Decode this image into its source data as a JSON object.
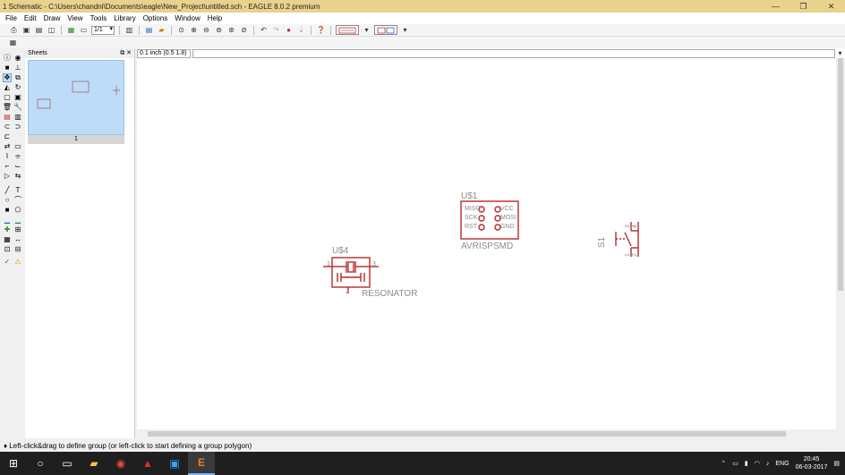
{
  "window": {
    "title": "1 Schematic - C:\\Users\\chandni\\Documents\\eagle\\New_Project\\untitled.sch - EAGLE 8.0.2 premium"
  },
  "menu": [
    "File",
    "Edit",
    "Draw",
    "View",
    "Tools",
    "Library",
    "Options",
    "Window",
    "Help"
  ],
  "toolbar": {
    "sheet_value": "1/1"
  },
  "sheets_panel": {
    "title": "Sheets",
    "sheet_number": "1"
  },
  "command_bar": {
    "coordinate": "0.1 inch (0.5 1.8)",
    "command_text": ""
  },
  "schematic": {
    "parts": [
      {
        "name": "U$1",
        "value": "AVRISPSMD",
        "pins_left": [
          "MISO",
          "SCK",
          "RST"
        ],
        "pins_right": [
          "VCC",
          "MOSI",
          "GND"
        ]
      },
      {
        "name": "U$4",
        "value": "RESONATOR",
        "pin_numbers": [
          "1",
          "2",
          "3"
        ]
      },
      {
        "name": "S1",
        "pin_numbers": [
          "3",
          "4",
          "1",
          "2"
        ]
      }
    ]
  },
  "status": {
    "text": "♦ Left-click&drag to define group (or left-click to start defining a group polygon)"
  },
  "taskbar": {
    "lang": "ENG",
    "time": "20:45",
    "date": "06-03-2017"
  },
  "colors": {
    "titlebar": "#e9d28d",
    "schematic_symbol": "#b42a2a",
    "schematic_text": "#8c8c8c",
    "sheet_thumbnail": "#bcdcf8",
    "taskbar": "#1f1f1f"
  }
}
